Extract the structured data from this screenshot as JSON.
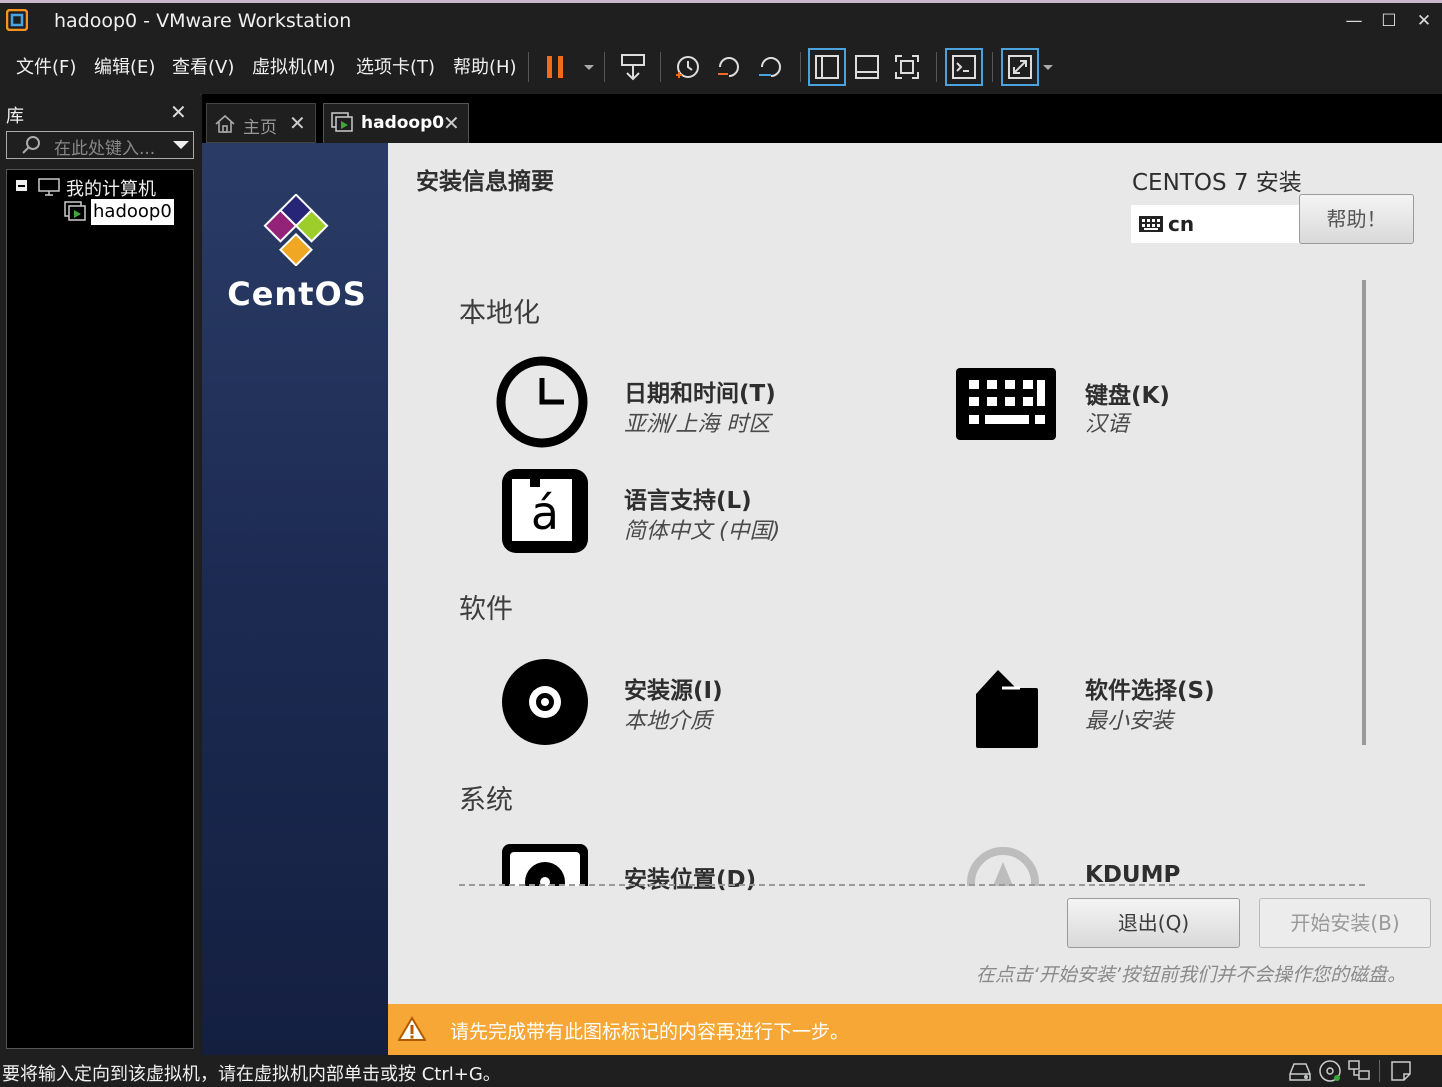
{
  "window": {
    "title": "hadoop0 - VMware Workstation"
  },
  "menu": {
    "items": [
      "文件(F)",
      "编辑(E)",
      "查看(V)",
      "虚拟机(M)",
      "选项卡(T)",
      "帮助(H)"
    ]
  },
  "library": {
    "title": "库",
    "search_placeholder": "在此处键入...",
    "tree": {
      "root": "我的计算机",
      "child": "hadoop0"
    }
  },
  "tabs": [
    {
      "label": "主页",
      "icon": "home-icon"
    },
    {
      "label": "hadoop0",
      "icon": "vm-icon"
    }
  ],
  "installer": {
    "header_title": "安装信息摘要",
    "product_title": "CENTOS 7 安装",
    "keyboard_layout": "cn",
    "help_button": "帮助！",
    "brand": "CentOS",
    "sections": {
      "localization": "本地化",
      "software": "软件",
      "system": "系统"
    },
    "spokes": {
      "datetime": {
        "title": "日期和时间(T)",
        "status": "亚洲/上海 时区",
        "icon": "clock-icon"
      },
      "keyboard": {
        "title": "键盘(K)",
        "status": "汉语",
        "icon": "keyboard-icon"
      },
      "language": {
        "title": "语言支持(L)",
        "status": "简体中文 (中国)",
        "icon": "language-icon"
      },
      "source": {
        "title": "安装源(I)",
        "status": "本地介质",
        "icon": "disc-icon"
      },
      "software": {
        "title": "软件选择(S)",
        "status": "最小安装",
        "icon": "package-icon"
      },
      "destination": {
        "title": "安装位置(D)",
        "icon": "disk-icon"
      },
      "kdump": {
        "title": "KDUMP",
        "icon": "kdump-icon"
      }
    },
    "quit_button": "退出(Q)",
    "begin_button": "开始安装(B)",
    "disclaimer": "在点击‘开始安装’按钮前我们并不会操作您的磁盘。",
    "warning": "请先完成带有此图标标记的内容再进行下一步。"
  },
  "status_bar": {
    "text": "要将输入定向到该虚拟机，请在虚拟机内部单击或按 Ctrl+G。"
  },
  "colors": {
    "accent_orange": "#f6a735",
    "sidebar_blue": "#1c2a52",
    "pause_orange": "#f26b1d"
  }
}
